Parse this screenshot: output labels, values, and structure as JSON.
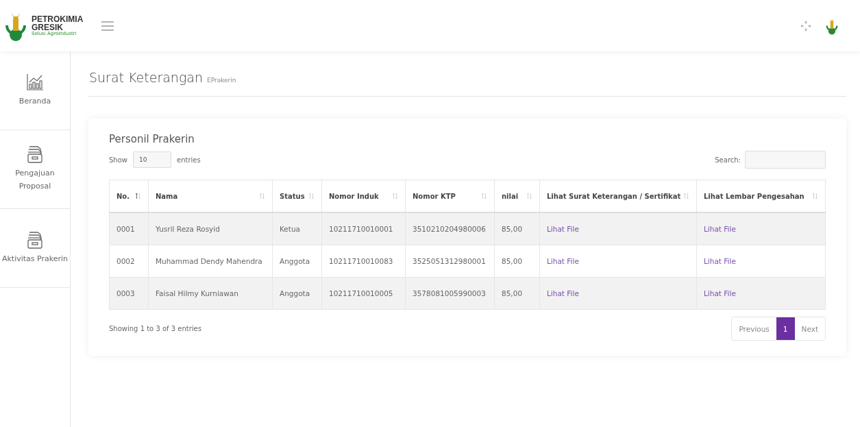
{
  "header": {
    "logo": {
      "name": "PETROKIMIA",
      "name2": "GRESIK",
      "tagline": "Solusi Agroindustri"
    }
  },
  "sidebar": {
    "items": [
      {
        "label": "Beranda"
      },
      {
        "label": "Pengajuan Proposal"
      },
      {
        "label": "Aktivitas Prakerin"
      }
    ]
  },
  "page": {
    "title": "Surat Keterangan",
    "subtitle": "EPrakerin"
  },
  "card": {
    "title": "Personil Prakerin",
    "show_label": "Show",
    "show_value": "10",
    "entries_label": "entries",
    "search_label": "Search:",
    "table": {
      "columns": [
        {
          "label": "No.",
          "sorted": true
        },
        {
          "label": "Nama",
          "sorted": false
        },
        {
          "label": "Status",
          "sorted": false
        },
        {
          "label": "Nomor Induk",
          "sorted": false
        },
        {
          "label": "Nomor KTP",
          "sorted": false
        },
        {
          "label": "nilai",
          "sorted": false
        },
        {
          "label": "Lihat Surat Keterangan / Sertifikat",
          "sorted": false
        },
        {
          "label": "Lihat Lembar Pengesahan",
          "sorted": false
        }
      ],
      "rows": [
        [
          "0001",
          "Yusril Reza Rosyid",
          "Ketua",
          "10211710010001",
          "3510210204980006",
          "85,00",
          "Lihat File",
          "Lihat File"
        ],
        [
          "0002",
          "Muhammad Dendy Mahendra",
          "Anggota",
          "10211710010083",
          "3525051312980001",
          "85,00",
          "Lihat File",
          "Lihat File"
        ],
        [
          "0003",
          "Faisal Hilmy Kurniawan",
          "Anggota",
          "10211710010005",
          "3578081005990003",
          "85,00",
          "Lihat File",
          "Lihat File"
        ]
      ]
    },
    "info": "Showing 1 to 3 of 3 entries",
    "pagination": [
      {
        "label": "Previous",
        "selected": false
      },
      {
        "label": "1",
        "selected": true
      },
      {
        "label": "Next",
        "selected": false
      }
    ]
  }
}
